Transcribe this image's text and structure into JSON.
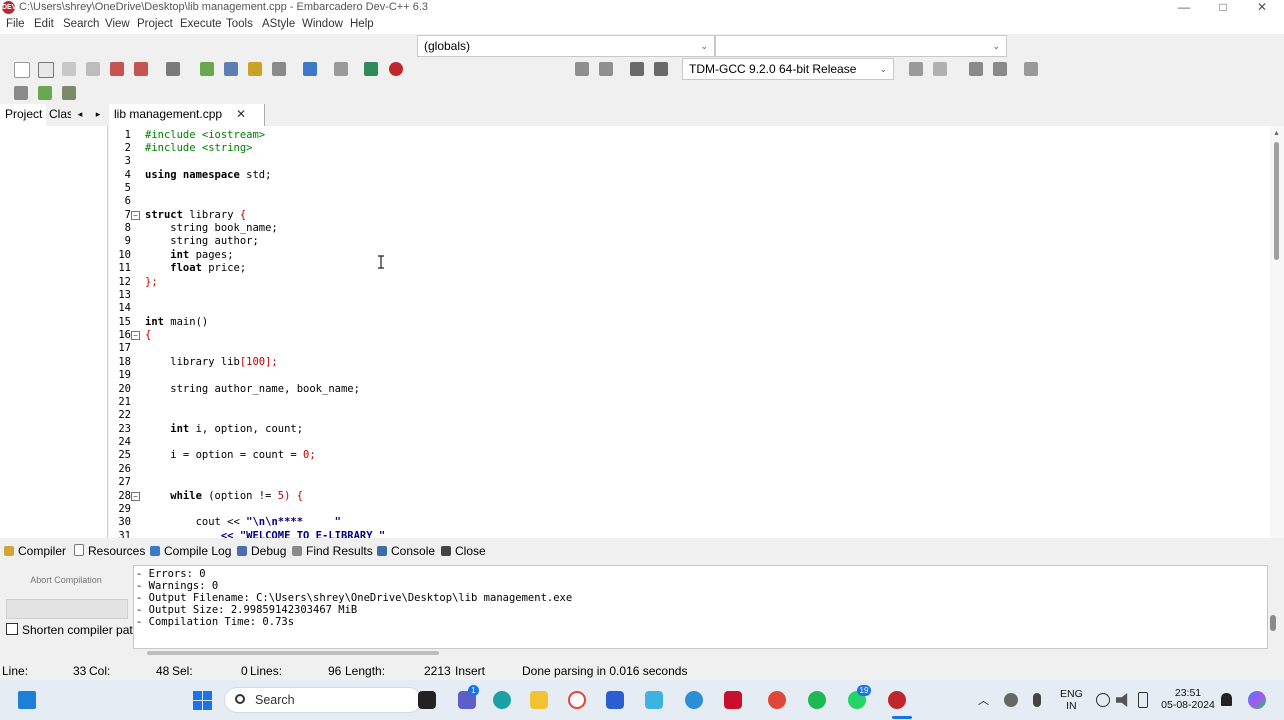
{
  "window": {
    "title": "C:\\Users\\shrey\\OneDrive\\Desktop\\lib management.cpp - Embarcadero Dev-C++ 6.3",
    "app_icon_text": "DEV",
    "minimize": "—",
    "maximize": "□",
    "close": "✕"
  },
  "menu": [
    "File",
    "Edit",
    "Search",
    "View",
    "Project",
    "Execute",
    "Tools",
    "AStyle",
    "Window",
    "Help"
  ],
  "toolbar": {
    "scope_combo": "(globals)",
    "function_combo": "",
    "compiler_combo": "TDM-GCC 9.2.0 64-bit Release",
    "combo_arrow": "⌄"
  },
  "left_tabs": {
    "project": "Project",
    "classes": "Clas",
    "prev": "◂",
    "next": "▸"
  },
  "file_tab": {
    "name": "lib management.cpp",
    "close": "✕"
  },
  "code": {
    "l1": "#include <iostream>",
    "l2": "#include <string>",
    "l4_kw": "using namespace",
    "l4_rest": " std;",
    "l7_kw": "struct",
    "l7_rest": " library ",
    "l7_sym": "{",
    "l8": "    string book_name;",
    "l9": "    string author;",
    "l10_kw": "    int",
    "l10_rest": " pages;",
    "l11_kw": "    float",
    "l11_rest": " price;",
    "l12": "};",
    "l15_kw": "int",
    "l15_rest": " main()",
    "l16": "{",
    "l18_a": "    library lib",
    "l18_b": "[100];",
    "l20": "    string author_name, book_name;",
    "l23_kw": "    int",
    "l23_rest": " i, option, count;",
    "l25_a": "    i = option = count = ",
    "l25_b": "0;",
    "l28_kw": "    while",
    "l28_a": " (option != ",
    "l28_b": "5) {",
    "l30_a": "        cout << ",
    "l30_b": "\"\\n\\n****     \"",
    "l31": "            << \"WELCOME TO E-LIBRARY \""
  },
  "fold_symbol": "−",
  "line_numbers": [
    "1",
    "2",
    "3",
    "4",
    "5",
    "6",
    "7",
    "8",
    "9",
    "10",
    "11",
    "12",
    "13",
    "14",
    "15",
    "16",
    "17",
    "18",
    "19",
    "20",
    "21",
    "22",
    "23",
    "24",
    "25",
    "26",
    "27",
    "28",
    "29",
    "30",
    "31"
  ],
  "bottom_tabs": [
    "Compiler",
    "Resources",
    "Compile Log",
    "Debug",
    "Find Results",
    "Console",
    "Close"
  ],
  "compile_panel": {
    "abort": "Abort Compilation",
    "shorten": "Shorten compiler pat"
  },
  "compile_log": [
    "- Errors: 0",
    "- Warnings: 0",
    "- Output Filename: C:\\Users\\shrey\\OneDrive\\Desktop\\lib management.exe",
    "- Output Size: 2.99859142303467 MiB",
    "- Compilation Time: 0.73s"
  ],
  "status": {
    "line_label": "Line:",
    "line": "33",
    "col_label": "Col:",
    "col": "48",
    "sel_label": "Sel:",
    "sel": "0",
    "lines_label": "Lines:",
    "lines": "96",
    "length_label": "Length:",
    "length": "2213",
    "mode": "Insert",
    "message": "Done parsing in 0.016 seconds"
  },
  "taskbar": {
    "search": "Search",
    "lang1": "ENG",
    "lang2": "IN",
    "time": "23:51",
    "date": "05-08-2024",
    "teams_badge": "1",
    "whatsapp_badge": "19"
  },
  "colors": {
    "preprocessor": "#008000",
    "symbol": "#c00000",
    "string": "#000080"
  }
}
